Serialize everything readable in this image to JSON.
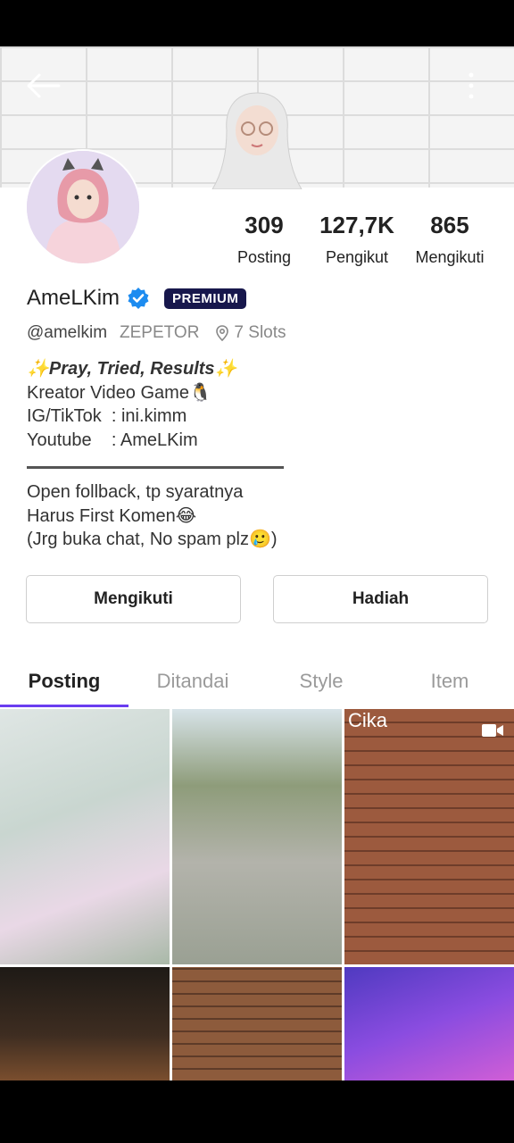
{
  "header": {
    "back_icon": "arrow-left-icon",
    "more_icon": "more-vertical-icon"
  },
  "profile": {
    "name": "AmeLKim",
    "badge": "PREMIUM",
    "handle": "@amelkim",
    "app_name": "ZEPETOR",
    "slots": "7 Slots",
    "bio_title": "✨Pray, Tried, Results✨",
    "bio_lines": "Kreator Video Game🐧\nIG/TikTok  : ini.kimm\nYoutube    : AmeLKim",
    "bio_note": "Open follback, tp syaratnya\nHarus First Komen😂\n(Jrg buka chat, No spam plz🥲)"
  },
  "stats": {
    "posts_value": "309",
    "posts_label": "Posting",
    "followers_value": "127,7K",
    "followers_label": "Pengikut",
    "following_value": "865",
    "following_label": "Mengikuti"
  },
  "actions": {
    "follow_label": "Mengikuti",
    "gift_label": "Hadiah"
  },
  "tabs": [
    {
      "label": "Posting",
      "active": true
    },
    {
      "label": "Ditandai",
      "active": false
    },
    {
      "label": "Style",
      "active": false
    },
    {
      "label": "Item",
      "active": false
    }
  ],
  "grid": {
    "third_caption": "Cika"
  },
  "colors": {
    "accent": "#6a3df0",
    "premium_badge": "#17174c",
    "verified": "#1d8cf0"
  }
}
